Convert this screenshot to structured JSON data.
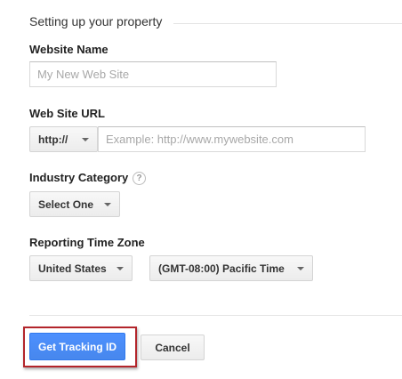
{
  "section": {
    "title": "Setting up your property"
  },
  "website_name": {
    "label": "Website Name",
    "placeholder": "My New Web Site",
    "value": ""
  },
  "website_url": {
    "label": "Web Site URL",
    "protocol": "http://",
    "placeholder": "Example: http://www.mywebsite.com",
    "value": ""
  },
  "industry": {
    "label": "Industry Category",
    "help_icon_text": "?",
    "selected": "Select One"
  },
  "timezone": {
    "label": "Reporting Time Zone",
    "country": "United States",
    "zone": "(GMT-08:00) Pacific Time"
  },
  "actions": {
    "primary_label": "Get Tracking ID",
    "cancel_label": "Cancel"
  },
  "icons": {
    "dropdown": "chevron-down-icon",
    "help": "help-icon"
  },
  "colors": {
    "primary_button": "#4d90fe",
    "highlight_border": "#b3252b"
  }
}
